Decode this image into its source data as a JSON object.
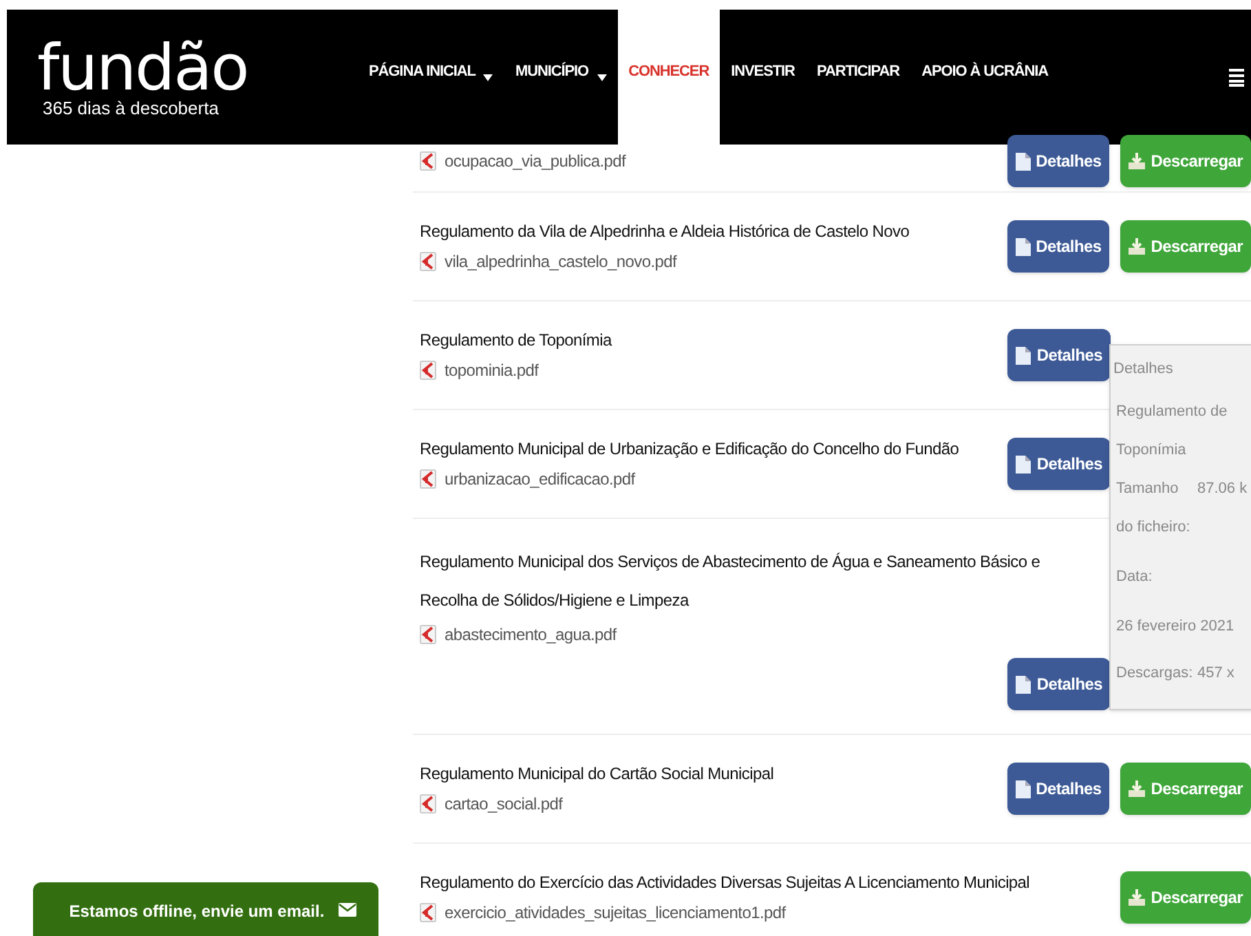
{
  "header": {
    "logo": "fundão",
    "tagline": "365 dias à descoberta",
    "nav": [
      {
        "label": "PÁGINA INICIAL",
        "dropdown": true,
        "selected": false
      },
      {
        "label": "MUNICÍPIO",
        "dropdown": true,
        "selected": false
      },
      {
        "label": "CONHECER",
        "dropdown": false,
        "selected": true
      },
      {
        "label": "INVESTIR",
        "dropdown": false,
        "selected": false
      },
      {
        "label": "PARTICIPAR",
        "dropdown": false,
        "selected": false
      },
      {
        "label": "APOIO À UCRÂNIA",
        "dropdown": false,
        "selected": false
      }
    ]
  },
  "documents": [
    {
      "file": "ocupacao_via_publica.pdf",
      "buttons": [
        {
          "kind": "details",
          "label": "Detalhes"
        },
        {
          "kind": "download",
          "label": "Descarregar"
        }
      ]
    },
    {
      "title": "Regulamento da Vila de Alpedrinha e Aldeia Histórica de Castelo Novo",
      "file": "vila_alpedrinha_castelo_novo.pdf",
      "buttons": [
        {
          "kind": "details",
          "label": "Detalhes"
        },
        {
          "kind": "download",
          "label": "Descarregar"
        }
      ]
    },
    {
      "title": "Regulamento de Toponímia",
      "file": "topominia.pdf",
      "buttons": [
        {
          "kind": "details",
          "label": "Detalhes"
        }
      ]
    },
    {
      "title": "Regulamento Municipal de Urbanização e Edificação do Concelho do Fundão",
      "file": "urbanizacao_edificacao.pdf",
      "buttons": [
        {
          "kind": "details",
          "label": "Detalhes"
        }
      ]
    },
    {
      "title": "Regulamento Municipal dos Serviços de Abastecimento de Água e Saneamento Básico e Recolha de Sólidos/Higiene e Limpeza",
      "file": "abastecimento_agua.pdf",
      "buttons": [
        {
          "kind": "details",
          "label": "Detalhes"
        }
      ]
    },
    {
      "title": "Regulamento Municipal do Cartão Social Municipal",
      "file": "cartao_social.pdf",
      "buttons": [
        {
          "kind": "details",
          "label": "Detalhes"
        },
        {
          "kind": "download",
          "label": "Descarregar"
        }
      ]
    },
    {
      "title": "Regulamento do Exercício das Actividades Diversas Sujeitas A Licenciamento Municipal",
      "file": "exercicio_atividades_sujeitas_licenciamento1.pdf",
      "buttons": [
        {
          "kind": "download",
          "label": "Descarregar"
        }
      ]
    }
  ],
  "popover": {
    "heading": "Detalhes",
    "title": "Regulamento de Toponímia",
    "fields": [
      {
        "label": "Tamanho do ficheiro:",
        "value": "87.06 k"
      },
      {
        "label": "Data:",
        "value": "26 fevereiro 2021",
        "kind": "stacked"
      },
      {
        "label": "Descargas:",
        "value": "457 x"
      }
    ]
  },
  "chat": {
    "text": "Estamos offline, envie um email."
  }
}
